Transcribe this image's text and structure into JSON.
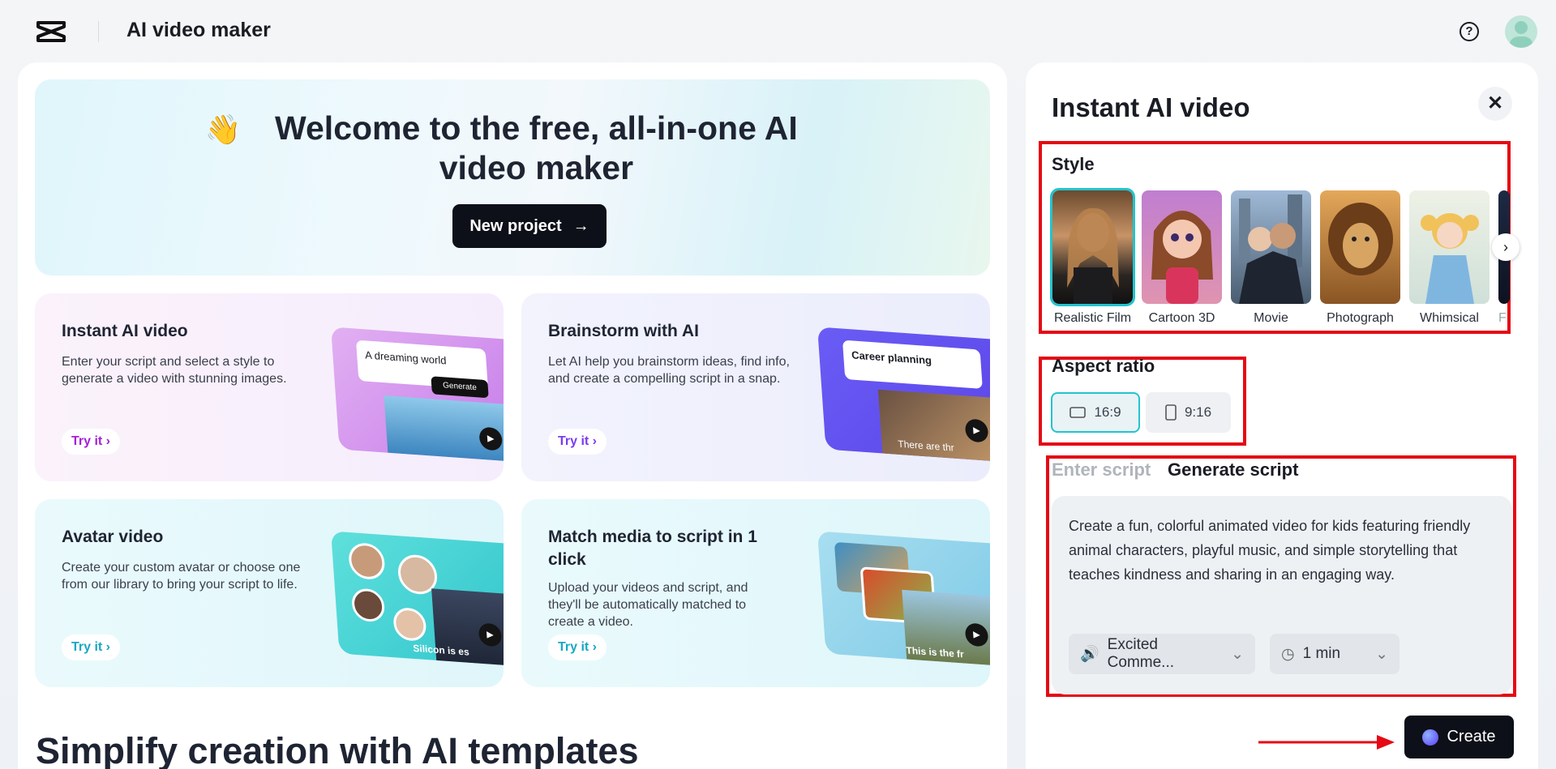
{
  "app": {
    "title": "AI video maker",
    "logo_icon": "capcut-logo-icon"
  },
  "header": {
    "help_icon": "help-circle-icon",
    "avatar_icon": "user-avatar-icon"
  },
  "hero": {
    "emoji": "👋",
    "title": "Welcome to the free, all-in-one AI video maker",
    "new_project_label": "New project"
  },
  "cards": [
    {
      "title": "Instant AI video",
      "desc": "Enter your script and select a style to generate a video with stunning images.",
      "try_label": "Try it",
      "thumb_text": "A dreaming world",
      "thumb_button": "Generate",
      "accent": "#a620d8"
    },
    {
      "title": "Brainstorm with AI",
      "desc": "Let AI help you brainstorm ideas, find info, and create a compelling script in a snap.",
      "try_label": "Try it",
      "thumb_text": "Career planning",
      "thumb_caption": "There are thr",
      "accent": "#7b3cf0"
    },
    {
      "title": "Avatar video",
      "desc": "Create your custom avatar or choose one from our library to bring your script to life.",
      "try_label": "Try it",
      "thumb_caption": "Silicon is es",
      "accent": "#17a8c4"
    },
    {
      "title": "Match media to script in 1 click",
      "desc": "Upload your videos and script, and they'll be automatically matched to create a video.",
      "try_label": "Try it",
      "thumb_caption": "This is the fr",
      "accent": "#17a8c4"
    }
  ],
  "section_title": "Simplify creation with AI templates",
  "panel": {
    "title": "Instant AI video",
    "close_icon": "close-icon",
    "style_label": "Style",
    "styles": [
      {
        "name": "Realistic Film",
        "selected": true
      },
      {
        "name": "Cartoon 3D",
        "selected": false
      },
      {
        "name": "Movie",
        "selected": false
      },
      {
        "name": "Photograph",
        "selected": false
      },
      {
        "name": "Whimsical",
        "selected": false
      },
      {
        "name": "F",
        "selected": false
      }
    ],
    "aspect_label": "Aspect ratio",
    "aspect_options": [
      {
        "label": "16:9",
        "selected": true,
        "icon": "landscape-icon"
      },
      {
        "label": "9:16",
        "selected": false,
        "icon": "portrait-icon"
      }
    ],
    "tabs": [
      {
        "label": "Enter script",
        "active": false
      },
      {
        "label": "Generate script",
        "active": true
      }
    ],
    "script_text": "Create a fun, colorful animated video for kids featuring friendly animal characters, playful music, and simple storytelling that teaches kindness and sharing in an engaging way.",
    "voice_label": "Excited Comme...",
    "duration_label": "1 min",
    "create_label": "Create"
  },
  "colors": {
    "accent": "#21c4cf",
    "highlight_box": "#e50914",
    "dark_button": "#0d1018"
  }
}
